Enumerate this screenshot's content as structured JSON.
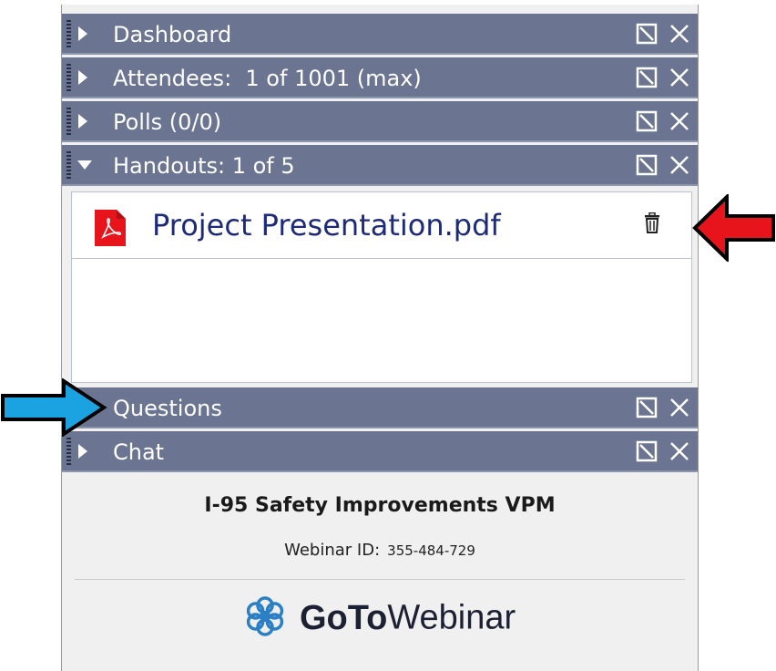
{
  "panels": [
    {
      "label": "Dashboard",
      "expanded": false
    },
    {
      "label": "Attendees:  1 of 1001 (max)",
      "expanded": false
    },
    {
      "label": "Polls (0/0)",
      "expanded": false
    },
    {
      "label": "Handouts: 1 of 5",
      "expanded": true
    },
    {
      "label": "Questions",
      "expanded": false
    },
    {
      "label": "Chat",
      "expanded": false
    }
  ],
  "handouts": {
    "items": [
      {
        "name": "Project Presentation.pdf",
        "icon": "pdf-file-icon"
      }
    ]
  },
  "footer": {
    "webinar_title": "I-95 Safety Improvements VPM",
    "webinar_id_label": "Webinar ID:",
    "webinar_id": "355-484-729",
    "brand_goto": "GoTo",
    "brand_webinar": "Webinar"
  },
  "annotations": {
    "red_arrow_color": "#e8141c",
    "blue_arrow_color": "#1aa3e0"
  },
  "colors": {
    "panel_bar": "#6b7592",
    "pdf_red": "#e8141c",
    "brand_blue": "#2b7fc4",
    "handout_text": "#1d2a7a"
  }
}
